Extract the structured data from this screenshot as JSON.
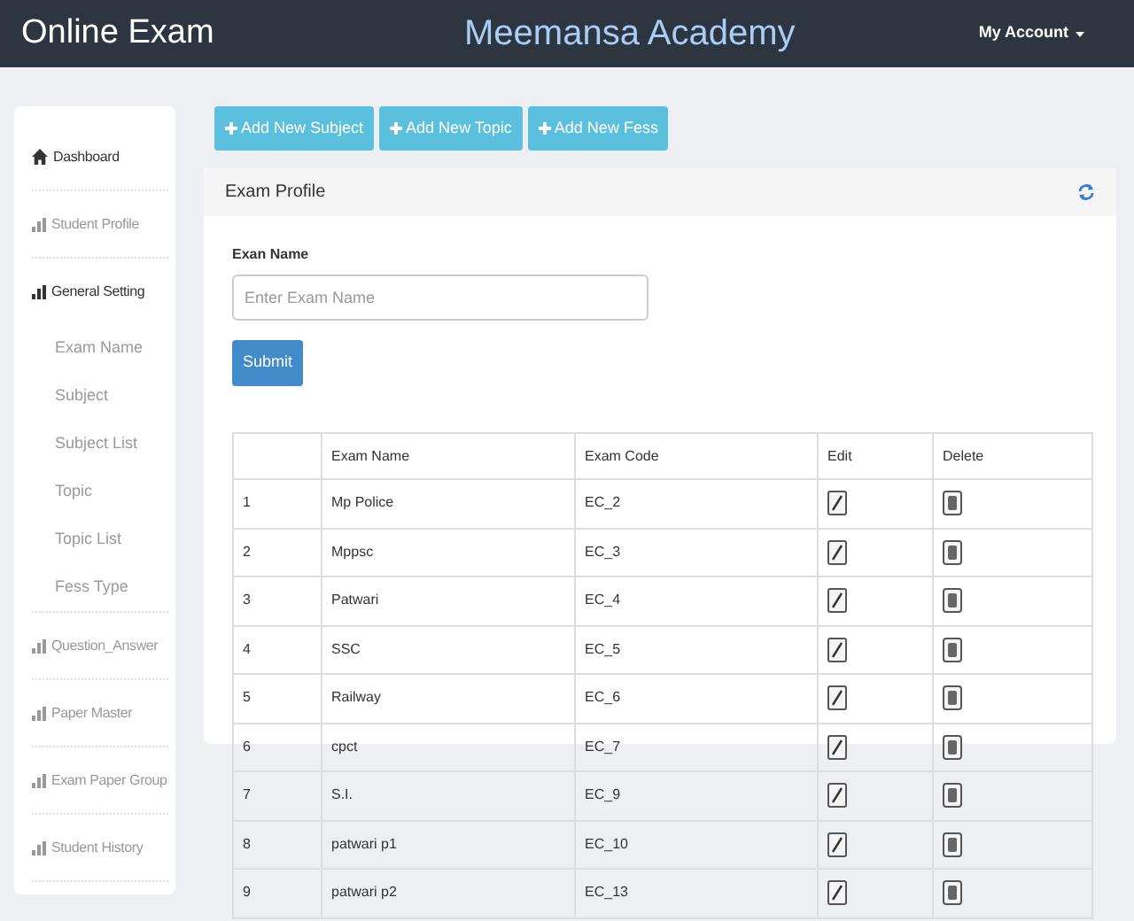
{
  "navbar": {
    "brand": "Online Exam",
    "title": "Meemansa Academy",
    "account": "My Account"
  },
  "sidebar": {
    "items": [
      {
        "label": "Dashboard",
        "kind": "home",
        "highlighted": true
      },
      {
        "label": "Student Profile",
        "kind": "chart",
        "highlighted": false
      },
      {
        "label": "General Setting",
        "kind": "chart",
        "highlighted": true,
        "children": [
          {
            "label": "Exam Name"
          },
          {
            "label": "Subject"
          },
          {
            "label": "Subject List"
          },
          {
            "label": "Topic"
          },
          {
            "label": "Topic List"
          },
          {
            "label": "Fess Type"
          }
        ]
      },
      {
        "label": "Question_Answer",
        "kind": "chart",
        "highlighted": false
      },
      {
        "label": "Paper Master",
        "kind": "chart",
        "highlighted": false
      },
      {
        "label": "Exam Paper Group",
        "kind": "chart",
        "highlighted": false
      },
      {
        "label": "Student History",
        "kind": "chart",
        "highlighted": false
      }
    ]
  },
  "toolbar": {
    "buttons": [
      "Add New Subject",
      "Add New Topic",
      "Add New Fess"
    ]
  },
  "panel": {
    "title": "Exam Profile",
    "form": {
      "label": "Exan Name",
      "placeholder": "Enter Exam Name",
      "submit": "Submit"
    },
    "table": {
      "columns": [
        "",
        "Exam Name",
        "Exam Code",
        "Edit",
        "Delete"
      ],
      "rows": [
        {
          "number": "1",
          "name": "Mp Police",
          "code": "EC_2"
        },
        {
          "number": "2",
          "name": "Mppsc",
          "code": "EC_3"
        },
        {
          "number": "3",
          "name": "Patwari",
          "code": "EC_4"
        },
        {
          "number": "4",
          "name": "SSC",
          "code": "EC_5"
        },
        {
          "number": "5",
          "name": "Railway",
          "code": "EC_6"
        },
        {
          "number": "6",
          "name": "cpct",
          "code": "EC_7"
        },
        {
          "number": "7",
          "name": "S.I.",
          "code": "EC_9"
        },
        {
          "number": "8",
          "name": "patwari p1",
          "code": "EC_10"
        },
        {
          "number": "9",
          "name": "patwari p2",
          "code": "EC_13"
        }
      ]
    }
  }
}
